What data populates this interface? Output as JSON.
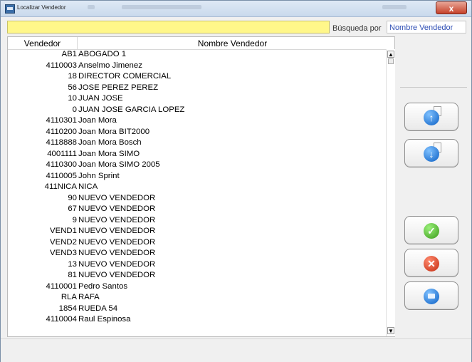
{
  "window": {
    "title": "Localizar Vendedor",
    "close_label": "x"
  },
  "search": {
    "value": "",
    "label": "Búsqueda por",
    "field": "Nombre Vendedor"
  },
  "table": {
    "columns": [
      "Vendedor",
      "Nombre Vendedor"
    ],
    "rows": [
      {
        "code": "AB1",
        "name": "ABOGADO 1"
      },
      {
        "code": "4110003",
        "name": "Anselmo Jimenez"
      },
      {
        "code": "18",
        "name": "DIRECTOR COMERCIAL"
      },
      {
        "code": "56",
        "name": "JOSE PEREZ PEREZ"
      },
      {
        "code": "10",
        "name": "JUAN JOSE"
      },
      {
        "code": "0",
        "name": "JUAN JOSE GARCIA LOPEZ"
      },
      {
        "code": "4110301",
        "name": "Joan Mora"
      },
      {
        "code": "4110200",
        "name": "Joan Mora BIT2000"
      },
      {
        "code": "4118888",
        "name": "Joan Mora Bosch"
      },
      {
        "code": "4001111",
        "name": "Joan Mora SIMO"
      },
      {
        "code": "4110300",
        "name": "Joan Mora SIMO 2005"
      },
      {
        "code": "4110005",
        "name": "John Sprint"
      },
      {
        "code": "411NICA",
        "name": "NICA"
      },
      {
        "code": "90",
        "name": "NUEVO VENDEDOR"
      },
      {
        "code": "67",
        "name": "NUEVO VENDEDOR"
      },
      {
        "code": "9",
        "name": "NUEVO VENDEDOR"
      },
      {
        "code": "VEND1",
        "name": "NUEVO VENDEDOR"
      },
      {
        "code": "VEND2",
        "name": "NUEVO VENDEDOR"
      },
      {
        "code": "VEND3",
        "name": "NUEVO VENDEDOR"
      },
      {
        "code": "13",
        "name": "NUEVO VENDEDOR"
      },
      {
        "code": "81",
        "name": "NUEVO VENDEDOR"
      },
      {
        "code": "4110001",
        "name": "Pedro Santos"
      },
      {
        "code": "RLA",
        "name": "RAFA"
      },
      {
        "code": "1854",
        "name": "RUEDA 54"
      },
      {
        "code": "4110004",
        "name": "Raul Espinosa"
      }
    ]
  },
  "buttons": {
    "move_up": "up-arrow-icon",
    "move_down": "down-arrow-icon",
    "accept": "check-icon",
    "cancel": "x-icon",
    "keyboard": "keyboard-icon"
  },
  "colors": {
    "search_bg": "#fff78a",
    "link_blue": "#2f4fb5",
    "accept_green": "#3a9a1a",
    "cancel_red": "#c32a0f",
    "button_blue": "#0b5fc4"
  }
}
